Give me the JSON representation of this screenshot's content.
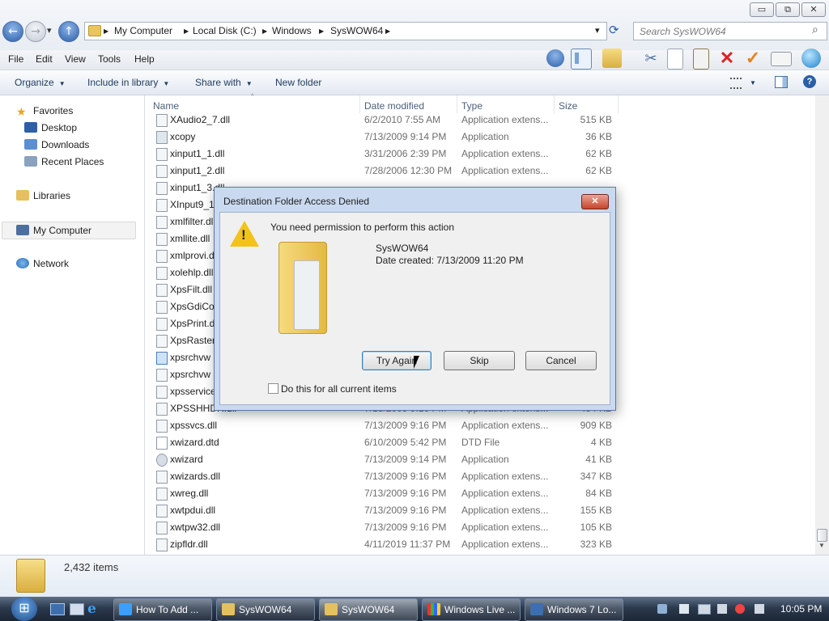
{
  "window": {
    "minimize_glyph": "▭",
    "maximize_glyph": "⧉",
    "close_glyph": "✕"
  },
  "nav": {
    "back_glyph": "←",
    "forward_glyph": "→",
    "dropdown_glyph": "▾",
    "up_glyph": "↑"
  },
  "address": {
    "crumbs": [
      "My Computer",
      "Local Disk (C:)",
      "Windows",
      "SysWOW64"
    ],
    "separator": "▶",
    "dropdown_glyph": "▾",
    "refresh_glyph": "⟳"
  },
  "search": {
    "placeholder": "Search SysWOW64",
    "icon_glyph": "⌕"
  },
  "menubar": [
    "File",
    "Edit",
    "View",
    "Tools",
    "Help"
  ],
  "toolbar_icons": [
    "up-arrow-icon",
    "folder-pane-icon",
    "move-icon",
    "cut-icon",
    "copy-icon",
    "paste-icon",
    "delete-icon",
    "properties-check-icon",
    "email-icon",
    "globe-icon"
  ],
  "commandbar": {
    "organize": "Organize",
    "include_in_library": "Include in library",
    "share_with": "Share with",
    "new_folder": "New folder",
    "help_glyph": "?"
  },
  "navpane": {
    "favorites": "Favorites",
    "desktop": "Desktop",
    "downloads": "Downloads",
    "recent_places": "Recent Places",
    "libraries": "Libraries",
    "my_computer": "My Computer",
    "network": "Network"
  },
  "columns": {
    "name": "Name",
    "date_modified": "Date modified",
    "type": "Type",
    "size": "Size"
  },
  "files": [
    {
      "name": "XAudio2_7.dll",
      "date": "6/2/2010 7:55 AM",
      "type": "Application extens...",
      "size": "515 KB"
    },
    {
      "name": "xcopy",
      "date": "7/13/2009 9:14 PM",
      "type": "Application",
      "size": "36 KB"
    },
    {
      "name": "xinput1_1.dll",
      "date": "3/31/2006 2:39 PM",
      "type": "Application extens...",
      "size": "62 KB"
    },
    {
      "name": "xinput1_2.dll",
      "date": "7/28/2006 12:30 PM",
      "type": "Application extens...",
      "size": "62 KB"
    },
    {
      "name": "xinput1_3.dll",
      "date": "",
      "type": "",
      "size": ""
    },
    {
      "name": "XInput9_1_0.dll",
      "date": "",
      "type": "",
      "size": ""
    },
    {
      "name": "xmlfilter.dll",
      "date": "",
      "type": "",
      "size": ""
    },
    {
      "name": "xmllite.dll",
      "date": "",
      "type": "",
      "size": ""
    },
    {
      "name": "xmlprovi.dll",
      "date": "",
      "type": "",
      "size": ""
    },
    {
      "name": "xolehlp.dll",
      "date": "",
      "type": "",
      "size": ""
    },
    {
      "name": "XpsFilt.dll",
      "date": "",
      "type": "",
      "size": ""
    },
    {
      "name": "XpsGdiConverter.dll",
      "date": "",
      "type": "",
      "size": ""
    },
    {
      "name": "XpsPrint.dll",
      "date": "",
      "type": "",
      "size": ""
    },
    {
      "name": "XpsRasterService.dll",
      "date": "",
      "type": "",
      "size": ""
    },
    {
      "name": "xpsrchvw",
      "date": "",
      "type": "",
      "size": ""
    },
    {
      "name": "xpsrchvw",
      "date": "",
      "type": "",
      "size": ""
    },
    {
      "name": "xpsservices.dll",
      "date": "",
      "type": "",
      "size": ""
    },
    {
      "name": "XPSSHHDR.dll",
      "date": "7/13/2009 9:16 PM",
      "type": "Application extens...",
      "size": "454 KB"
    },
    {
      "name": "xpssvcs.dll",
      "date": "7/13/2009 9:16 PM",
      "type": "Application extens...",
      "size": "909 KB"
    },
    {
      "name": "xwizard.dtd",
      "date": "6/10/2009 5:42 PM",
      "type": "DTD File",
      "size": "4 KB"
    },
    {
      "name": "xwizard",
      "date": "7/13/2009 9:14 PM",
      "type": "Application",
      "size": "41 KB"
    },
    {
      "name": "xwizards.dll",
      "date": "7/13/2009 9:16 PM",
      "type": "Application extens...",
      "size": "347 KB"
    },
    {
      "name": "xwreg.dll",
      "date": "7/13/2009 9:16 PM",
      "type": "Application extens...",
      "size": "84 KB"
    },
    {
      "name": "xwtpdui.dll",
      "date": "7/13/2009 9:16 PM",
      "type": "Application extens...",
      "size": "155 KB"
    },
    {
      "name": "xwtpw32.dll",
      "date": "7/13/2009 9:16 PM",
      "type": "Application extens...",
      "size": "105 KB"
    },
    {
      "name": "zipfldr.dll",
      "date": "4/11/2019 11:37 PM",
      "type": "Application extens...",
      "size": "323 KB"
    }
  ],
  "status": {
    "item_count": "2,432 items"
  },
  "dialog": {
    "title": "Destination Folder Access Denied",
    "close_glyph": "✕",
    "message": "You need permission to perform this action",
    "warning_glyph": "!",
    "folder_name": "SysWOW64",
    "date_created": "Date created: 7/13/2009 11:20 PM",
    "try_again": "Try Again",
    "skip": "Skip",
    "cancel": "Cancel",
    "checkbox_label": "Do this for all current items"
  },
  "taskbar": {
    "start_glyph": "⊞",
    "tasks": [
      "How To Add ...",
      "SysWOW64",
      "SysWOW64",
      "Windows Live ...",
      "Windows 7 Lo..."
    ],
    "clock": "10:05 PM",
    "tray_icons": [
      "network-icon",
      "flag-icon",
      "display-icon",
      "power-icon",
      "volume-icon"
    ]
  }
}
